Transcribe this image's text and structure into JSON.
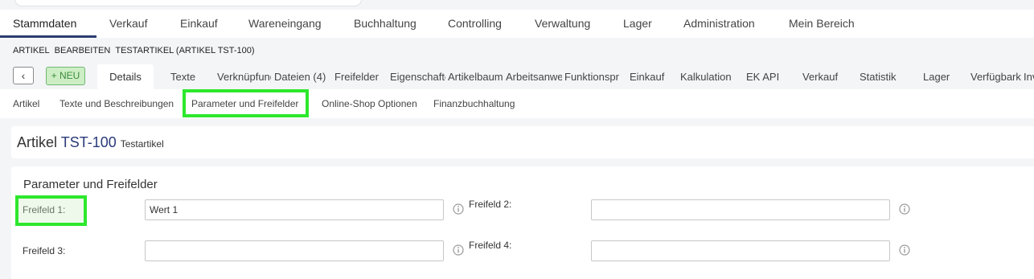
{
  "main_nav": [
    {
      "label": "Stammdaten",
      "active": true
    },
    {
      "label": "Verkauf"
    },
    {
      "label": "Einkauf"
    },
    {
      "label": "Wareneingang"
    },
    {
      "label": "Buchhaltung"
    },
    {
      "label": "Controlling"
    },
    {
      "label": "Verwaltung"
    },
    {
      "label": "Lager"
    },
    {
      "label": "Administration"
    },
    {
      "label": "Mein Bereich"
    }
  ],
  "breadcrumb": [
    "ARTIKEL",
    "BEARBEITEN",
    "TESTARTIKEL (ARTIKEL TST-100)"
  ],
  "toolbar": {
    "back_glyph": "‹",
    "new_label": "+ NEU"
  },
  "tabs": [
    "Details",
    "Texte",
    "Verknüpfungen",
    "Dateien (4)",
    "Freifelder",
    "Eigenschaften",
    "Artikelbaum",
    "Arbeitsanweisungen",
    "Funktionsprotokoll",
    "Einkauf",
    "Kalkulation",
    "EK API",
    "Verkauf",
    "Statistik",
    "Lager",
    "Verfügbarkeit",
    "Inventur"
  ],
  "subtabs": [
    "Artikel",
    "Texte und Beschreibungen",
    "Parameter und Freifelder",
    "Online-Shop Optionen",
    "Finanzbuchhaltung"
  ],
  "header": {
    "prefix": "Artikel",
    "code": "TST-100",
    "name": "Testartikel"
  },
  "section": {
    "title": "Parameter und Freifelder",
    "fields": [
      {
        "label": "Freifeld 1:",
        "value": "Wert 1"
      },
      {
        "label": "Freifeld 2:",
        "value": ""
      },
      {
        "label": "Freifeld 3:",
        "value": ""
      },
      {
        "label": "Freifeld 4:",
        "value": ""
      }
    ]
  },
  "colors": {
    "accent": "#2c3e70",
    "code": "#2a3a7a",
    "new_bg": "#cdeec5",
    "new_text": "#3c8a3c",
    "highlight": "#2de82d"
  },
  "icons": {
    "info": "info-circle-icon",
    "back": "chevron-left-icon"
  }
}
